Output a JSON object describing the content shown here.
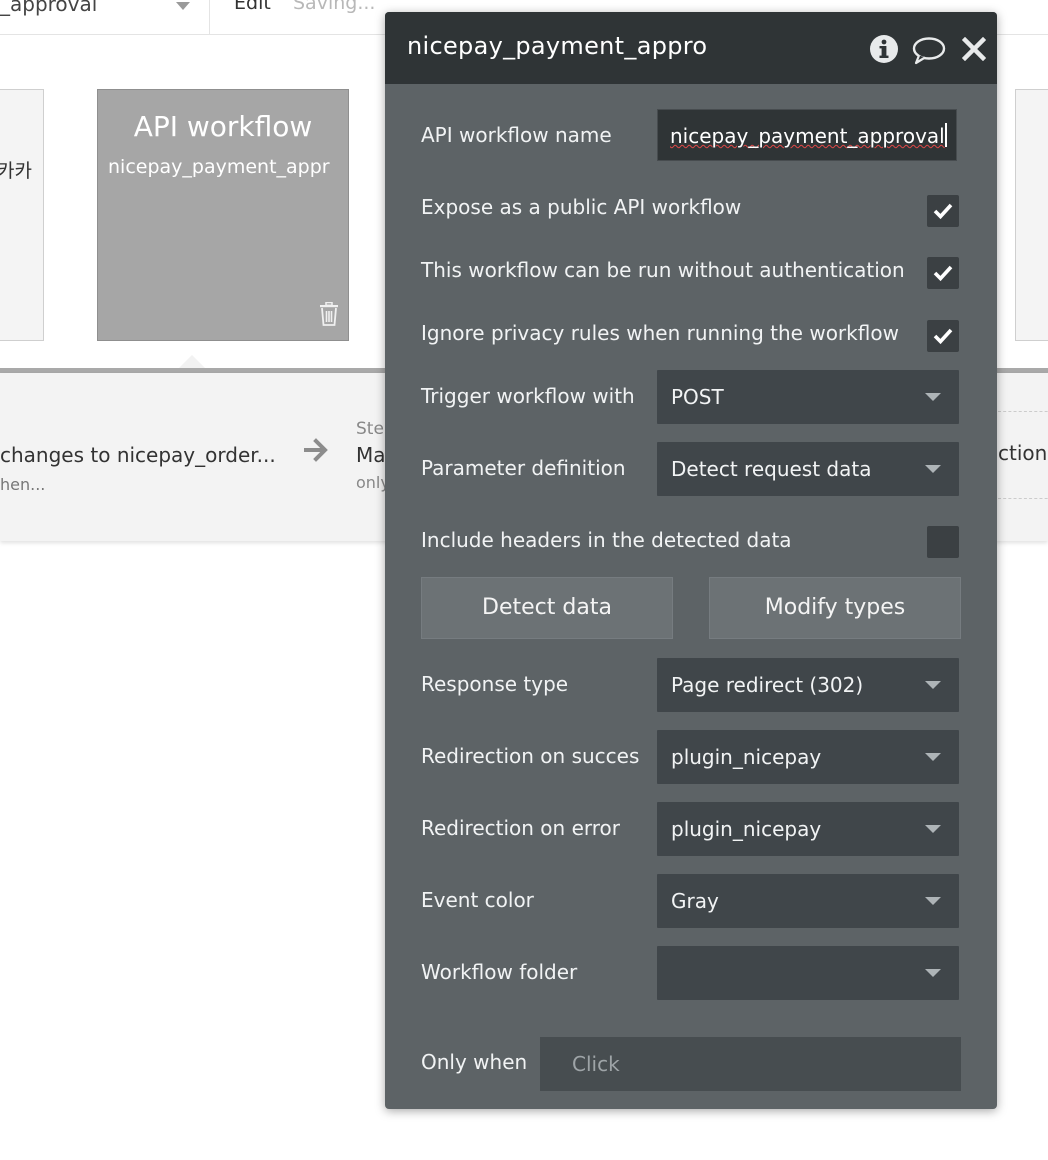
{
  "topbar": {
    "workflow_select": "_approval",
    "edit_label": "Edit",
    "saving_label": "Saving..."
  },
  "canvas": {
    "left_card": {
      "line1": "/",
      "line2": "카카"
    },
    "api_card": {
      "title": "API workflow",
      "subtitle": "nicepay_payment_appr"
    },
    "steps": {
      "step1_text": "changes to nicepay_order...",
      "step1_sub": "hen...",
      "step2_label": "Step",
      "step2_action": "Ma",
      "step2_only": "only",
      "right_text": "ction"
    }
  },
  "panel": {
    "title": "nicepay_payment_appro",
    "icons": {
      "info": "info-icon",
      "comment": "comment-icon",
      "close": "close-icon"
    },
    "name_label": "API workflow name",
    "name_value": "nicepay_payment_approval",
    "expose_label": "Expose as a public API workflow",
    "expose_checked": true,
    "noauth_label": "This workflow can be run without authentication",
    "noauth_checked": true,
    "privacy_label": "Ignore privacy rules when running the workflow",
    "privacy_checked": true,
    "trigger_label": "Trigger workflow with",
    "trigger_value": "POST",
    "param_label": "Parameter definition",
    "param_value": "Detect request data",
    "headers_label": "Include headers in the detected data",
    "headers_checked": false,
    "detect_button": "Detect data",
    "modify_button": "Modify types",
    "response_label": "Response type",
    "response_value": "Page redirect (302)",
    "success_label": "Redirection on succes",
    "success_value": "plugin_nicepay",
    "error_label": "Redirection on error",
    "error_value": "plugin_nicepay",
    "color_label": "Event color",
    "color_value": "Gray",
    "folder_label": "Workflow folder",
    "folder_value": "",
    "only_when_label": "Only when",
    "only_when_placeholder": "Click"
  }
}
